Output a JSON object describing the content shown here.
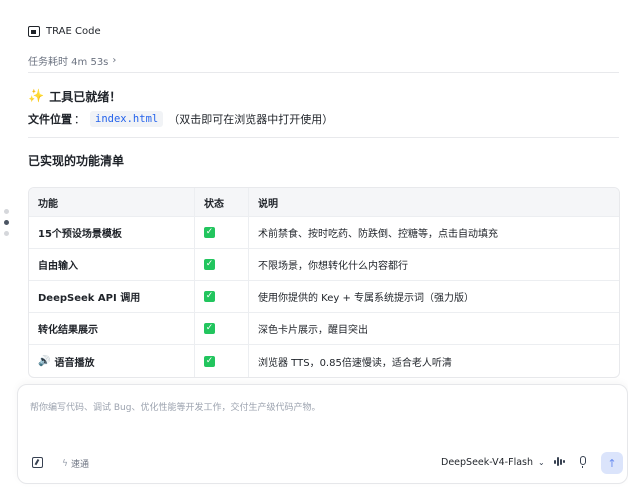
{
  "app": {
    "name": "TRAE Code"
  },
  "task": {
    "time_label": "任务耗时 4m 53s"
  },
  "message": {
    "ready_heading": "工具已就绪！",
    "file_label": "文件位置",
    "file_colon": "：",
    "file_name": "index.html",
    "file_note": "（双击即可在浏览器中打开使用）",
    "features_title": "已实现的功能清单"
  },
  "table": {
    "headers": [
      "功能",
      "状态",
      "说明"
    ],
    "rows": [
      {
        "feature": "15个预设场景模板",
        "status": "done",
        "desc": "术前禁食、按时吃药、防跌倒、控糖等，点击自动填充"
      },
      {
        "feature": "自由输入",
        "status": "done",
        "desc": "不限场景，你想转化什么内容都行"
      },
      {
        "feature": "DeepSeek API 调用",
        "status": "done",
        "desc": "使用你提供的 Key + 专属系统提示词（强力版）"
      },
      {
        "feature": "转化结果展示",
        "status": "done",
        "desc": "深色卡片展示，醒目突出"
      },
      {
        "feature": "语音播放",
        "status": "done",
        "desc": "浏览器 TTS，0.85倍速慢读，适合老人听清"
      }
    ]
  },
  "composer": {
    "placeholder": "帮你编写代码、调试 Bug、优化性能等开发工作，交付生产级代码产物。",
    "fast_label": "速通",
    "model_name": "DeepSeek-V4-Flash"
  },
  "icons": {
    "app": "window-icon",
    "sparkle": "sparkle-icon",
    "check": "checkmark-icon",
    "speaker": "speaker-icon",
    "send": "arrow-up-icon"
  },
  "colors": {
    "check_green": "#22c55e",
    "link_blue": "#2563eb",
    "send_bg": "#dbe4fb"
  }
}
